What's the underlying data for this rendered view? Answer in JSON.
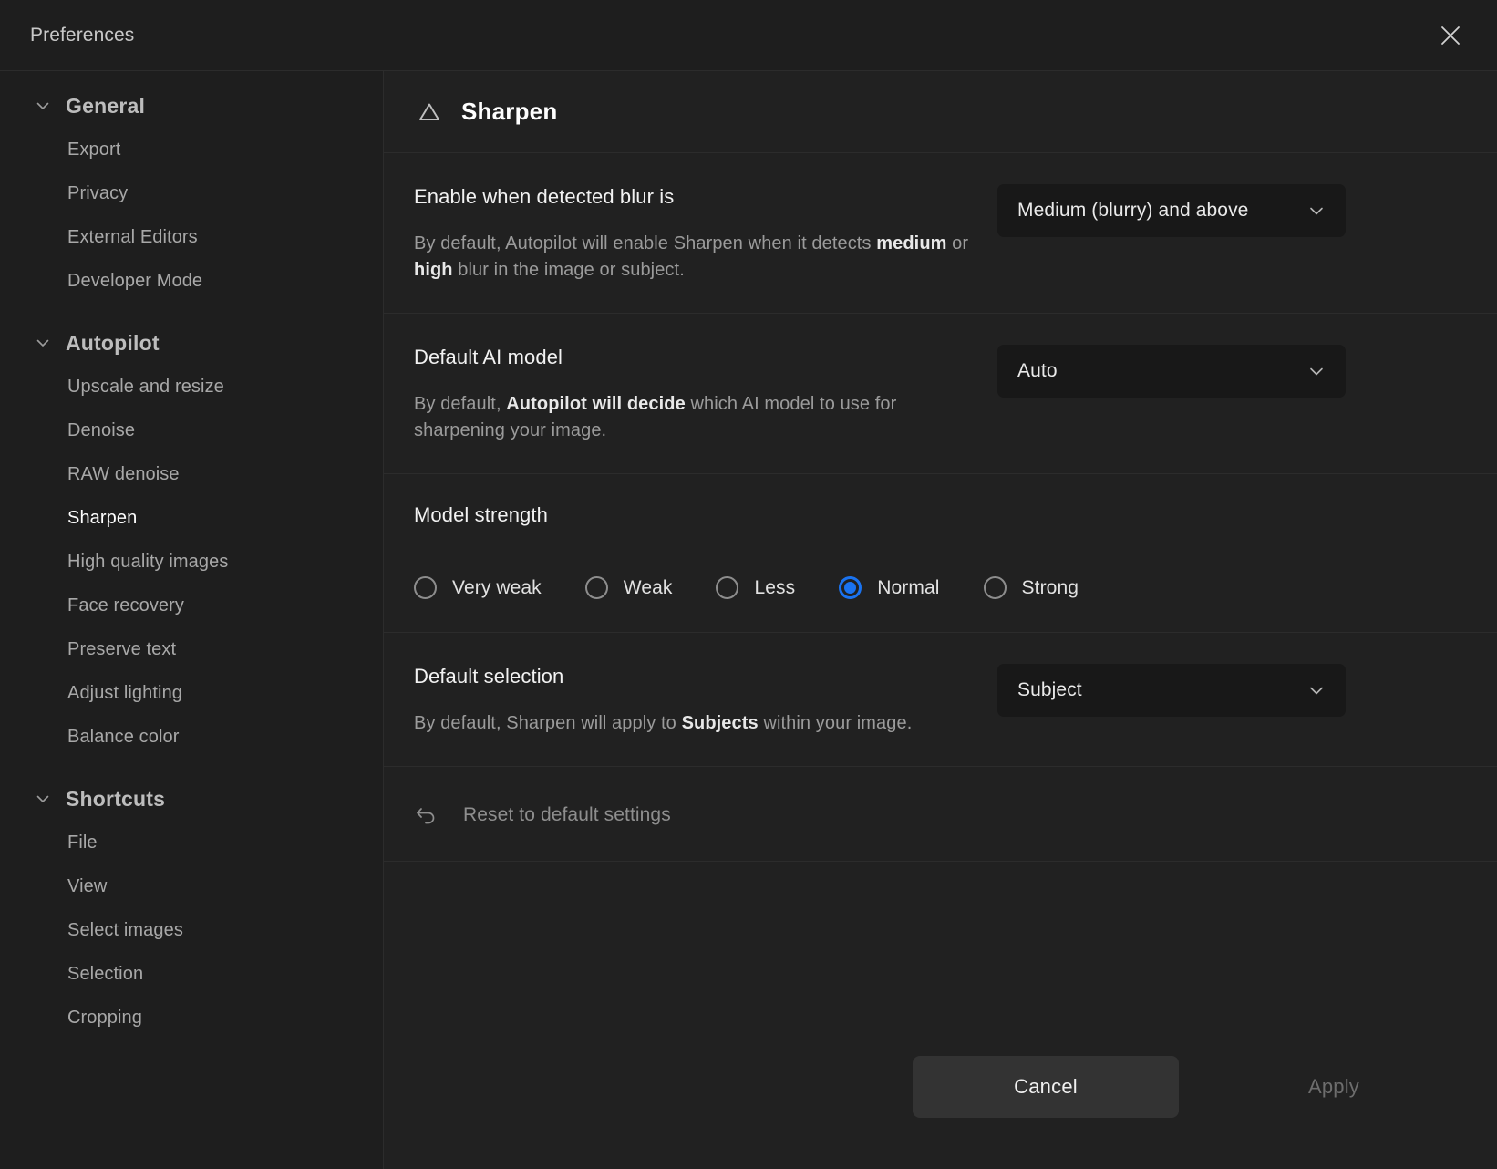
{
  "window": {
    "title": "Preferences",
    "close_icon": "close-icon"
  },
  "sidebar": {
    "groups": [
      {
        "label": "General",
        "caret_icon": "chevron-down-icon",
        "items": [
          {
            "label": "Export",
            "active": false
          },
          {
            "label": "Privacy",
            "active": false
          },
          {
            "label": "External Editors",
            "active": false
          },
          {
            "label": "Developer Mode",
            "active": false
          }
        ]
      },
      {
        "label": "Autopilot",
        "caret_icon": "chevron-down-icon",
        "items": [
          {
            "label": "Upscale and resize",
            "active": false
          },
          {
            "label": "Denoise",
            "active": false
          },
          {
            "label": "RAW denoise",
            "active": false
          },
          {
            "label": "Sharpen",
            "active": true
          },
          {
            "label": "High quality images",
            "active": false
          },
          {
            "label": "Face recovery",
            "active": false
          },
          {
            "label": "Preserve text",
            "active": false
          },
          {
            "label": "Adjust lighting",
            "active": false
          },
          {
            "label": "Balance color",
            "active": false
          }
        ]
      },
      {
        "label": "Shortcuts",
        "caret_icon": "chevron-down-icon",
        "items": [
          {
            "label": "File",
            "active": false
          },
          {
            "label": "View",
            "active": false
          },
          {
            "label": "Select images",
            "active": false
          },
          {
            "label": "Selection",
            "active": false
          },
          {
            "label": "Cropping",
            "active": false
          }
        ]
      }
    ]
  },
  "panel": {
    "icon": "triangle-outline-icon",
    "title": "Sharpen",
    "settings": {
      "blur_threshold": {
        "title": "Enable when detected blur is",
        "desc_parts": [
          {
            "text": "By default, Autopilot will enable Sharpen when it detects ",
            "bold": false
          },
          {
            "text": "medium",
            "bold": true
          },
          {
            "text": " or ",
            "bold": false
          },
          {
            "text": "high",
            "bold": true
          },
          {
            "text": " blur in the image or subject.",
            "bold": false
          }
        ],
        "value": "Medium (blurry) and above",
        "caret_icon": "chevron-down-icon"
      },
      "default_model": {
        "title": "Default AI model",
        "desc_parts": [
          {
            "text": "By default, ",
            "bold": false
          },
          {
            "text": "Autopilot will decide",
            "bold": true
          },
          {
            "text": " which AI model to use for sharpening your image.",
            "bold": false
          }
        ],
        "value": "Auto",
        "caret_icon": "chevron-down-icon"
      },
      "model_strength": {
        "title": "Model strength",
        "options": [
          {
            "label": "Very weak",
            "selected": false
          },
          {
            "label": "Weak",
            "selected": false
          },
          {
            "label": "Less",
            "selected": false
          },
          {
            "label": "Normal",
            "selected": true
          },
          {
            "label": "Strong",
            "selected": false
          }
        ]
      },
      "default_selection": {
        "title": "Default selection",
        "desc_parts": [
          {
            "text": "By default, Sharpen will apply to ",
            "bold": false
          },
          {
            "text": "Subjects",
            "bold": true
          },
          {
            "text": " within your image.",
            "bold": false
          }
        ],
        "value": "Subject",
        "caret_icon": "chevron-down-icon"
      }
    },
    "reset": {
      "icon": "undo-arrow-icon",
      "label": "Reset to default settings"
    },
    "footer": {
      "cancel_label": "Cancel",
      "apply_label": "Apply"
    }
  },
  "colors": {
    "accent": "#1a73f0",
    "window_bg": "#1e1e1e",
    "panel_bg": "#212121",
    "divider": "#2c2c2c",
    "dropdown_bg": "#181818",
    "cancel_bg": "#333333"
  }
}
